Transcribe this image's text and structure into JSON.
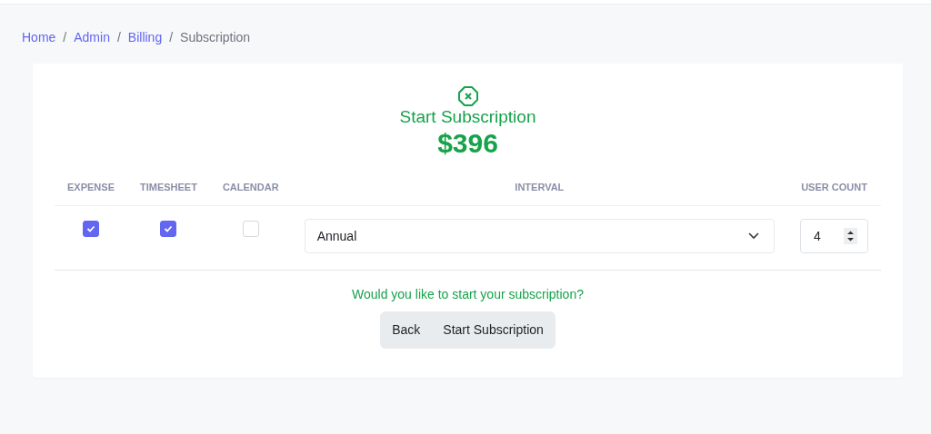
{
  "breadcrumb": [
    {
      "label": "Home",
      "kind": "link"
    },
    {
      "label": "/",
      "kind": "separator"
    },
    {
      "label": "Admin",
      "kind": "link"
    },
    {
      "label": "/",
      "kind": "separator"
    },
    {
      "label": "Billing",
      "kind": "link"
    },
    {
      "label": "/",
      "kind": "separator"
    },
    {
      "label": "Subscription",
      "kind": "current"
    }
  ],
  "header": {
    "title": "Start Subscription",
    "price": "$396"
  },
  "table": {
    "columns": [
      "EXPENSE",
      "TIMESHEET",
      "CALENDAR",
      "INTERVAL",
      "USER COUNT"
    ],
    "row": {
      "expense": {
        "checked": true
      },
      "timesheet": {
        "checked": true
      },
      "calendar": {
        "checked": false
      },
      "interval": "Annual",
      "user_count": "4"
    }
  },
  "prompt": "Would you like to start your subscription?",
  "buttons": [
    "Back",
    "Start Subscription"
  ]
}
